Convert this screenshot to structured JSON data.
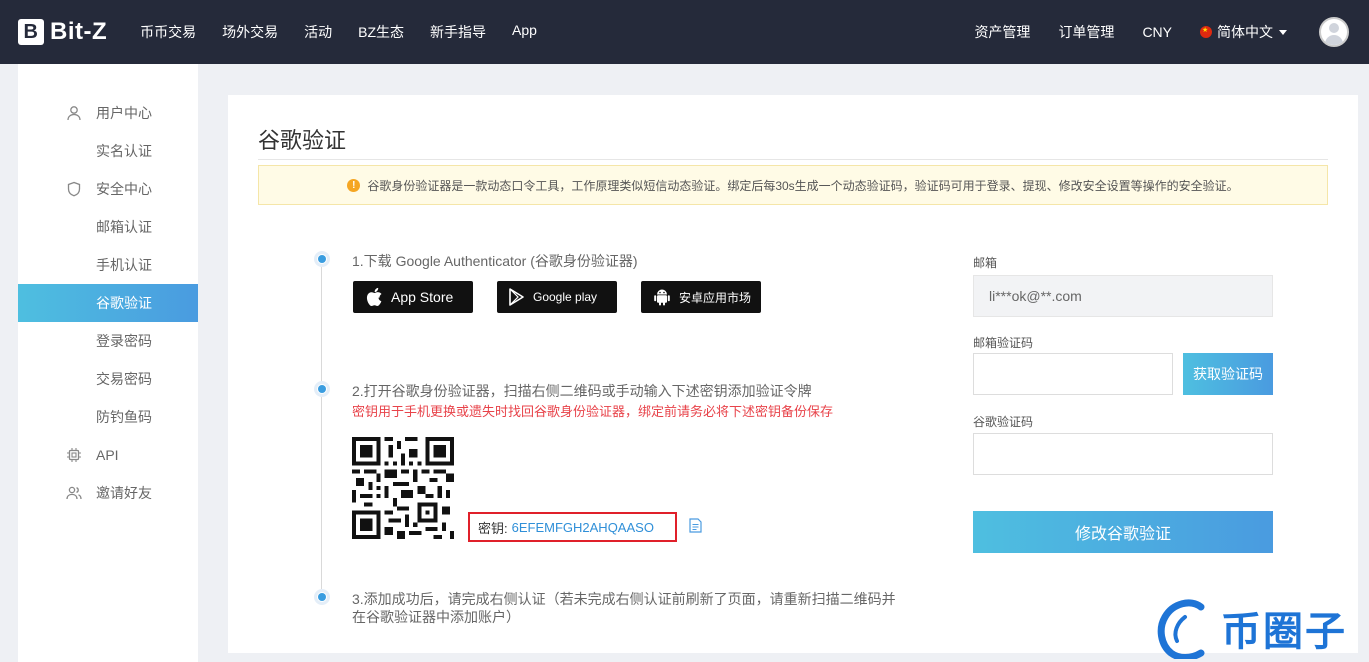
{
  "brand": {
    "name": "Bit-Z",
    "mark": "B"
  },
  "nav": {
    "left": [
      "币币交易",
      "场外交易",
      "活动",
      "BZ生态",
      "新手指导",
      "App"
    ],
    "right": [
      "资产管理",
      "订单管理",
      "CNY"
    ],
    "language": "简体中文"
  },
  "sidebar": {
    "items": [
      {
        "label": "用户中心",
        "icon": "user-icon"
      },
      {
        "label": "实名认证"
      },
      {
        "label": "安全中心",
        "icon": "shield-icon"
      },
      {
        "label": "邮箱认证"
      },
      {
        "label": "手机认证"
      },
      {
        "label": "谷歌验证",
        "active": true
      },
      {
        "label": "登录密码"
      },
      {
        "label": "交易密码"
      },
      {
        "label": "防钓鱼码"
      },
      {
        "label": "API",
        "icon": "chip-icon"
      },
      {
        "label": "邀请好友",
        "icon": "users-icon"
      }
    ]
  },
  "main": {
    "title": "谷歌验证",
    "notice": "谷歌身份验证器是一款动态口令工具，工作原理类似短信动态验证。绑定后每30s生成一个动态验证码，验证码可用于登录、提现、修改安全设置等操作的安全验证。",
    "step1": "1.下载 Google Authenticator (谷歌身份验证器)",
    "stores": {
      "appstore": "App Store",
      "googleplay": "Google play",
      "android": "安卓应用市场"
    },
    "step2": "2.打开谷歌身份验证器，扫描右侧二维码或手动输入下述密钥添加验证令牌",
    "step2_warning": "密钥用于手机更换或遗失时找回谷歌身份验证器，绑定前请务必将下述密钥备份保存",
    "key_label": "密钥:",
    "key_value": "6EFEMFGH2AHQAASO",
    "step3_line1": "3.添加成功后，请完成右侧认证（若未完成右侧认证前刷新了页面，请重新扫描二维码并",
    "step3_line2": "在谷歌验证器中添加账户）"
  },
  "form": {
    "email_label": "邮箱",
    "email_value": "li***ok@**.com",
    "email_code_label": "邮箱验证码",
    "email_code_value": "",
    "get_code_button": "获取验证码",
    "google_code_label": "谷歌验证码",
    "google_code_value": "",
    "submit_button": "修改谷歌验证"
  },
  "watermark": {
    "text": "币圈子"
  },
  "colors": {
    "nav_bg": "#252a3a",
    "accent": "#4a9be0",
    "warning_red": "#e8434a",
    "notice_bg": "#fffbe6"
  }
}
